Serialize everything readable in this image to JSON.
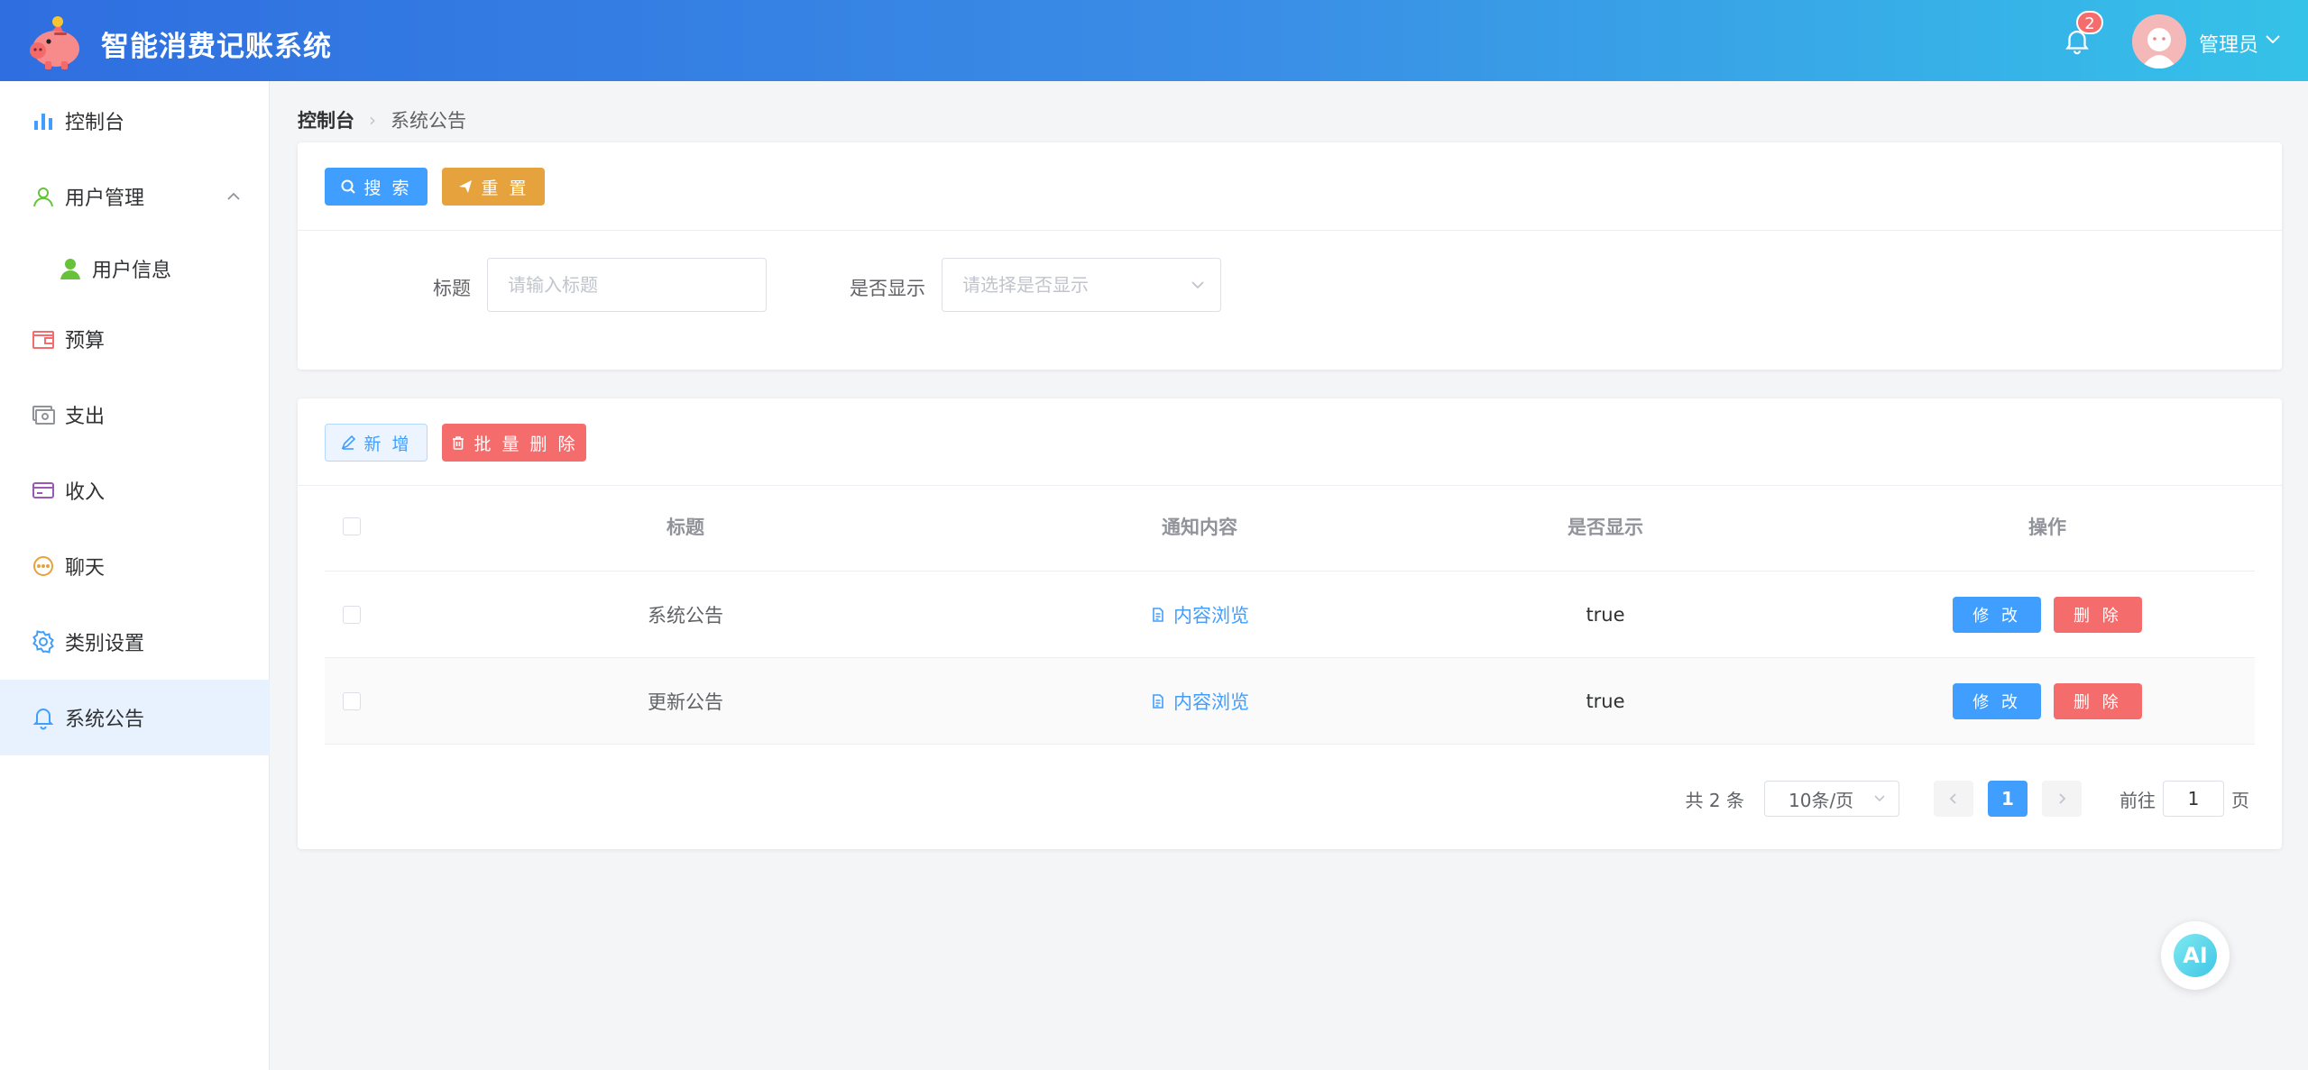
{
  "header": {
    "app_title": "智能消费记账系统",
    "notification_count": "2",
    "user_name": "管理员"
  },
  "sidebar": {
    "items": [
      {
        "label": "控制台",
        "icon": "bar-chart-icon"
      },
      {
        "label": "用户管理",
        "icon": "user-outline-icon",
        "expanded": true
      },
      {
        "label": "用户信息",
        "icon": "user-filled-icon",
        "sub": true
      },
      {
        "label": "预算",
        "icon": "wallet-icon"
      },
      {
        "label": "支出",
        "icon": "money-icon"
      },
      {
        "label": "收入",
        "icon": "card-icon"
      },
      {
        "label": "聊天",
        "icon": "chat-icon"
      },
      {
        "label": "类别设置",
        "icon": "gear-icon"
      },
      {
        "label": "系统公告",
        "icon": "bell-icon",
        "active": true
      }
    ]
  },
  "breadcrumb": {
    "home": "控制台",
    "current": "系统公告"
  },
  "search_card": {
    "search_label": "搜 索",
    "reset_label": "重 置",
    "title_label": "标题",
    "title_placeholder": "请输入标题",
    "show_label": "是否显示",
    "show_placeholder": "请选择是否显示"
  },
  "table_card": {
    "add_label": "新 增",
    "batch_delete_label": "批 量 删 除",
    "columns": [
      "标题",
      "通知内容",
      "是否显示",
      "操作"
    ],
    "rows": [
      {
        "title": "系统公告",
        "content_link": "内容浏览",
        "show": "true"
      },
      {
        "title": "更新公告",
        "content_link": "内容浏览",
        "show": "true"
      }
    ],
    "edit_label": "修 改",
    "delete_label": "删 除"
  },
  "pagination": {
    "total": "共 2 条",
    "page_size": "10条/页",
    "current_page": "1",
    "goto_label": "前往",
    "goto_value": "1",
    "goto_suffix": "页"
  },
  "ai_button": {
    "label": "AI"
  },
  "colors": {
    "primary": "#409eff",
    "warning": "#e6a23c",
    "danger": "#f56c6c",
    "header_start": "#2f6ee0",
    "header_end": "#35c2e8"
  }
}
